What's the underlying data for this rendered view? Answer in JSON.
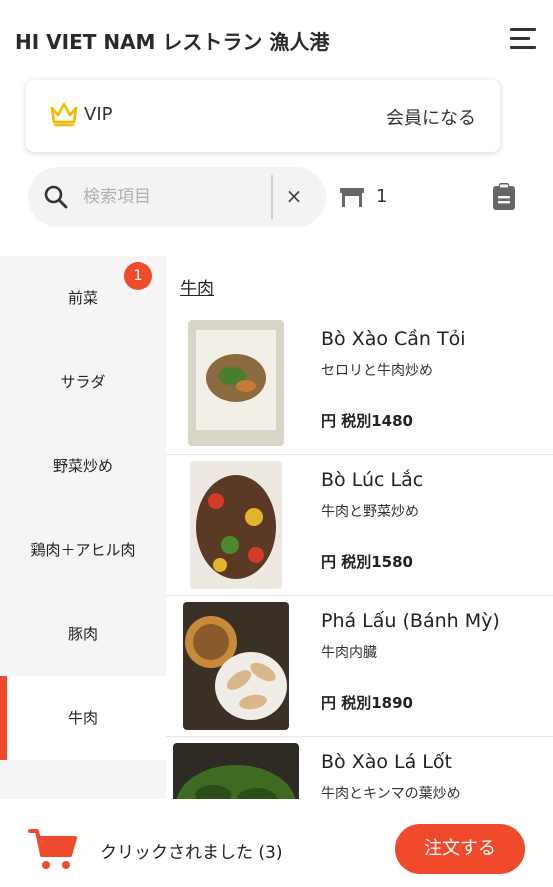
{
  "header": {
    "title": "HI VIET NAM レストラン 漁人港",
    "menu_icon": "hamburger-menu-icon"
  },
  "vip": {
    "label": "VIP",
    "join_label": "会員になる",
    "icon": "crown-icon",
    "icon_color": "#f5b800"
  },
  "search": {
    "placeholder": "検索項目",
    "value": "",
    "clear_label": "×"
  },
  "table": {
    "number": "1",
    "icon": "table-icon"
  },
  "order_list_icon": "clipboard-icon",
  "categories": [
    {
      "label": "前菜",
      "badge": "1",
      "active": false
    },
    {
      "label": "サラダ",
      "active": false
    },
    {
      "label": "野菜炒め",
      "active": false
    },
    {
      "label": "鶏肉＋アヒル肉",
      "active": false
    },
    {
      "label": "豚肉",
      "active": false
    },
    {
      "label": "牛肉",
      "active": true
    }
  ],
  "section": {
    "title": "牛肉"
  },
  "items": [
    {
      "name": "Bò Xào Cần Tỏi",
      "desc": "セロリと牛肉炒め",
      "price": "円 税別1480"
    },
    {
      "name": "Bò Lúc Lắc",
      "desc": "牛肉と野菜炒め",
      "price": "円 税別1580"
    },
    {
      "name": "Phá Lấu (Bánh Mỳ)",
      "desc": "牛肉内臓",
      "price": "円 税別1890"
    },
    {
      "name": "Bò Xào Lá Lốt",
      "desc": "牛肉とキンマの葉炒め",
      "price": ""
    }
  ],
  "cart": {
    "status_text": "クリックされました (3)",
    "icon": "cart-icon"
  },
  "order_button": {
    "label": "注文する"
  },
  "colors": {
    "accent": "#f04a2c",
    "sidebar_bg": "#f5f5f5"
  }
}
